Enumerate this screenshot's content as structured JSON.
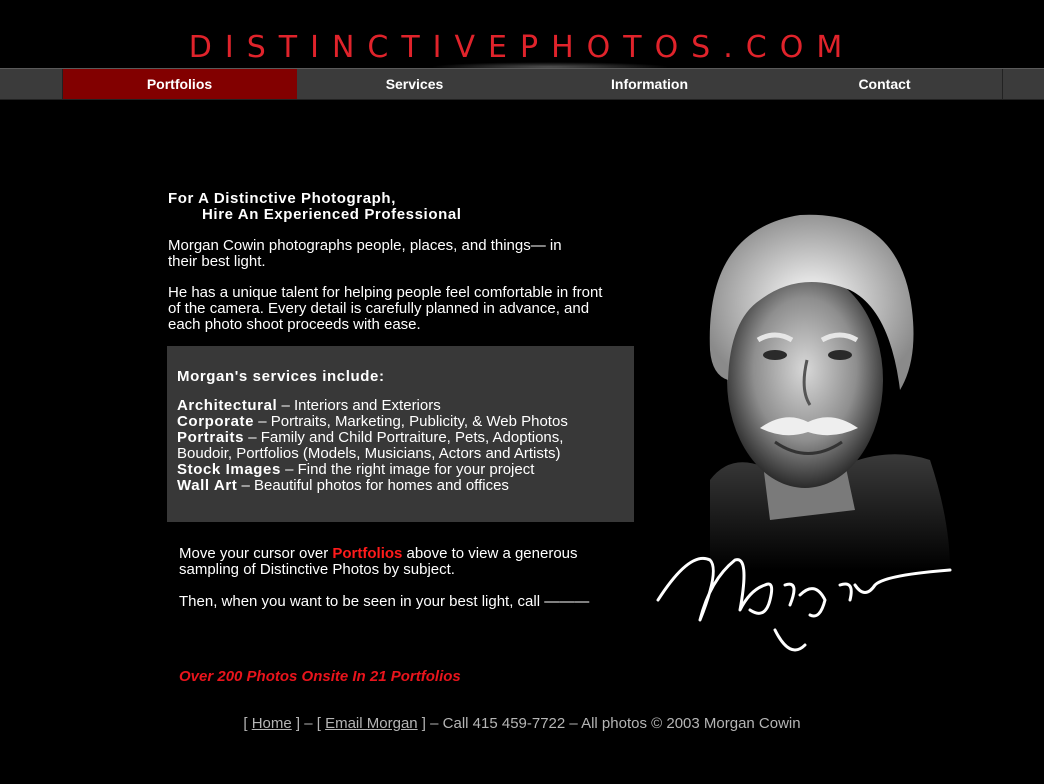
{
  "header": {
    "logo_text": "DISTINCTIVEPHOTOS.COM"
  },
  "nav": {
    "items": [
      {
        "label": "Portfolios",
        "active": true
      },
      {
        "label": "Services",
        "active": false
      },
      {
        "label": "Information",
        "active": false
      },
      {
        "label": "Contact",
        "active": false
      }
    ]
  },
  "intro": {
    "heading_line1": "For A Distinctive Photograph,",
    "heading_line2": "Hire An Experienced Professional",
    "para1": "Morgan Cowin photographs people, places, and things— in their best light.",
    "para2": "He has a unique talent for helping people feel comfortable in front of the camera. Every detail is carefully planned in advance, and each photo shoot proceeds with ease."
  },
  "services": {
    "title": "Morgan's services include:",
    "items": [
      {
        "name": "Architectural",
        "desc": " – Interiors and Exteriors"
      },
      {
        "name": "Corporate",
        "desc": "  – Portraits, Marketing, Publicity, & Web Photos"
      },
      {
        "name": "Portraits",
        "desc": " –  Family and Child Portraiture, Pets, Adoptions, Boudoir,  Portfolios (Models, Musicians, Actors and Artists)"
      },
      {
        "name": "Stock Images",
        "desc": " – Find the right image for your project"
      },
      {
        "name": "Wall Art",
        "desc": " – Beautiful photos for homes and offices"
      }
    ]
  },
  "cta": {
    "line1_pre": "Move your cursor over ",
    "line1_link": "Portfolios",
    "line1_post": " above to view a generous sampling of Distinctive Photos by subject.",
    "line2": "Then, when you want to be seen in your best light, call ———"
  },
  "photo_count": "Over 200 Photos Onsite In 21 Portfolios",
  "footer": {
    "open1": "[ ",
    "home": "Home",
    "sep1": " ] – [ ",
    "email": "Email Morgan",
    "rest": " ] – Call 415 459-7722 – All photos © 2003 Morgan Cowin"
  },
  "colors": {
    "accent_red": "#e0232b",
    "nav_active": "#820000",
    "nav_bg": "#3b3b3b",
    "box_bg": "#383838"
  },
  "icons": {
    "portrait": "portrait-photo-icon",
    "signature": "signature-icon"
  }
}
